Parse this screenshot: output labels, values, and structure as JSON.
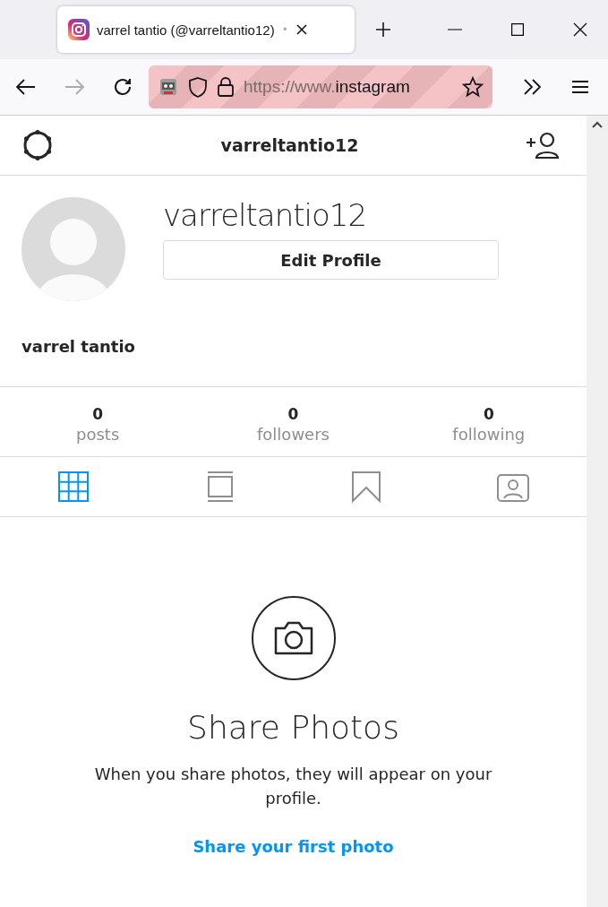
{
  "browser": {
    "tab_title": "varrel tantio (@varreltantio12)",
    "tab_dot": "•",
    "url_scheme": "https://www.",
    "url_host": "instagram"
  },
  "header": {
    "title": "varreltantio12"
  },
  "profile": {
    "username": "varreltantio12",
    "edit_button": "Edit Profile",
    "full_name": "varrel tantio"
  },
  "stats": [
    {
      "count": "0",
      "label": "posts"
    },
    {
      "count": "0",
      "label": "followers"
    },
    {
      "count": "0",
      "label": "following"
    }
  ],
  "tabs": [
    {
      "kind": "grid",
      "selected": true
    },
    {
      "kind": "feed",
      "selected": false
    },
    {
      "kind": "saved",
      "selected": false
    },
    {
      "kind": "tagged",
      "selected": false
    }
  ],
  "empty": {
    "title": "Share Photos",
    "text": "When you share photos, they will appear on your profile.",
    "link": "Share your first photo"
  }
}
